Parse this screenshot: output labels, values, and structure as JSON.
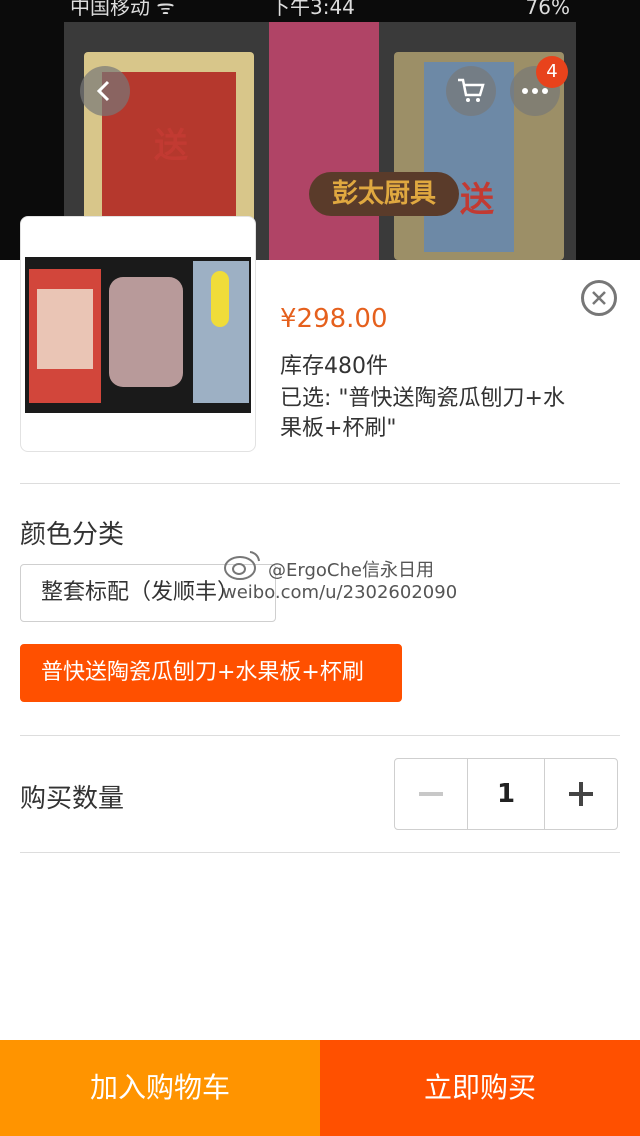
{
  "status_bar": {
    "carrier": "中国移动 ᯤ",
    "time": "下午3:44",
    "battery": "76%"
  },
  "background_page": {
    "watermark_text_left": "送",
    "watermark_text_right": "送",
    "shop_logo_text": "彭太厨具",
    "cart_badge_count": "4",
    "icons": [
      "chevron-left-icon",
      "cart-icon",
      "more-icon"
    ]
  },
  "product": {
    "price": "¥298.00",
    "stock": "库存480件",
    "selected": "已选: \"普快送陶瓷瓜刨刀+水果板+杯刷\""
  },
  "color_section": {
    "title": "颜色分类",
    "options": [
      {
        "label": "整套标配（发顺丰）",
        "selected": false
      },
      {
        "label": "普快送陶瓷瓜刨刀+水果板+杯刷",
        "selected": true
      }
    ]
  },
  "quantity_section": {
    "title": "购买数量",
    "value": "1"
  },
  "watermark": {
    "line1": "@ErgoChe信永日用",
    "line2": "weibo.com/u/2302602090"
  },
  "actions": {
    "add_to_cart": "加入购物车",
    "buy_now": "立即购买"
  },
  "colors": {
    "accent": "#ff5000",
    "cart_orange": "#ff9400",
    "price": "#e5601d"
  }
}
